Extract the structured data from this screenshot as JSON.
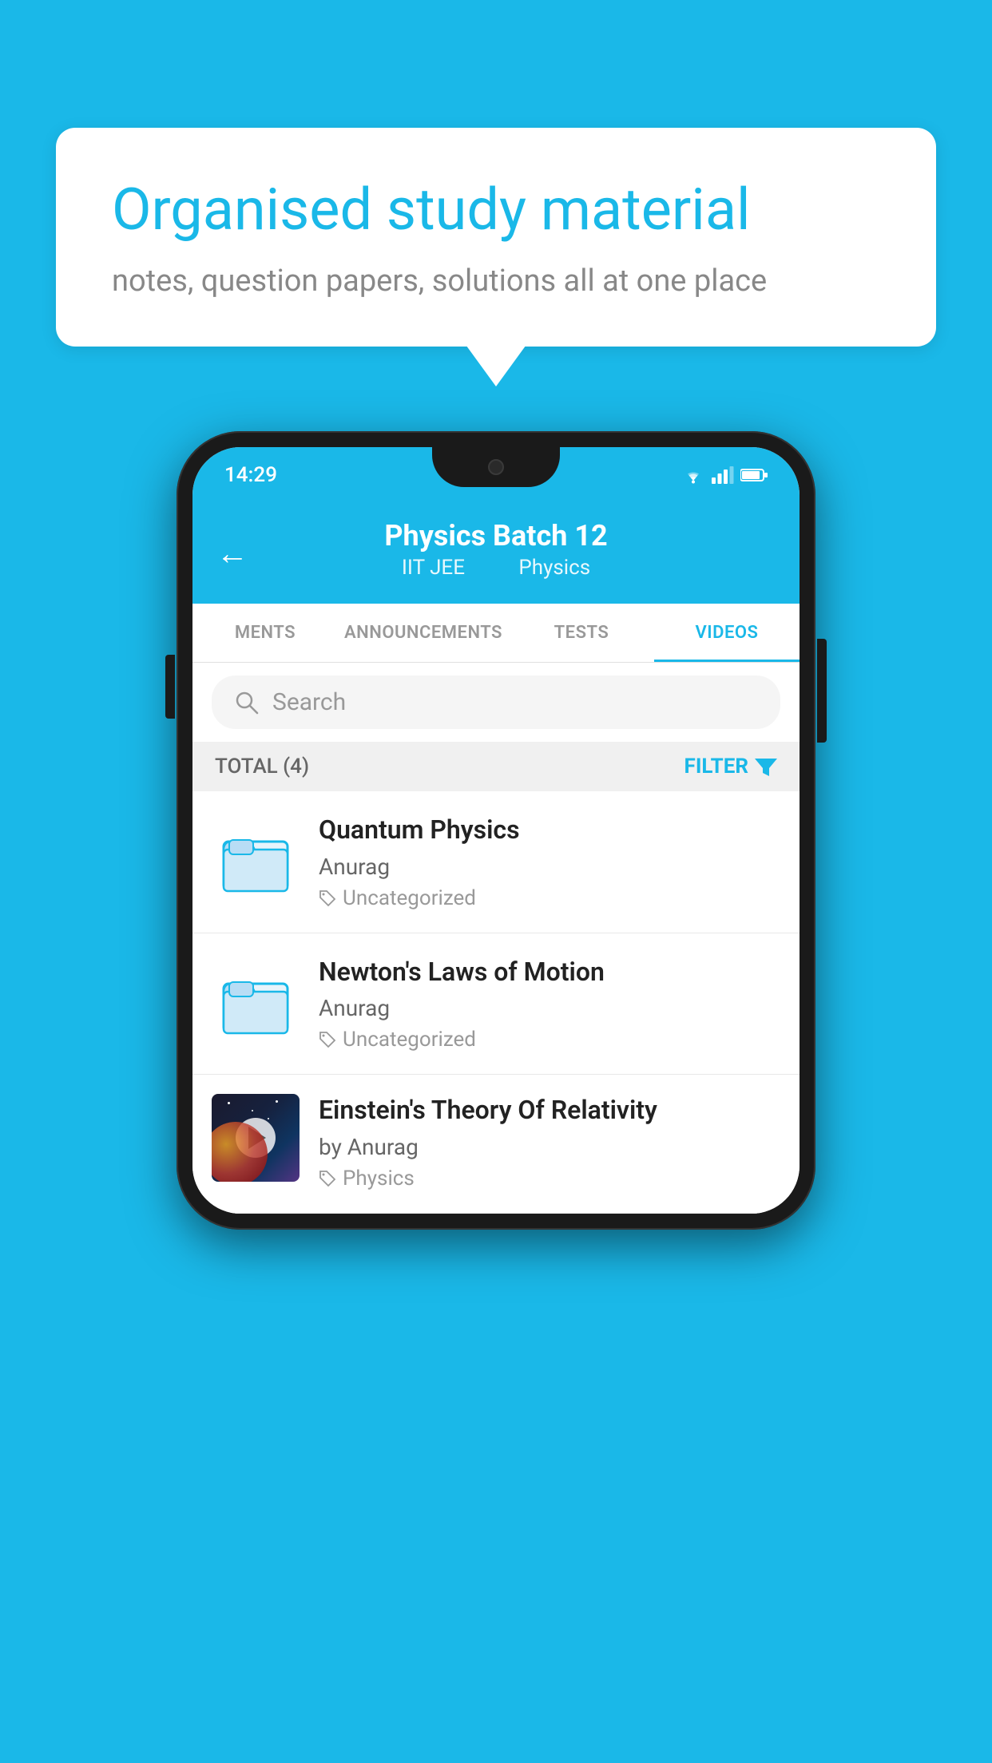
{
  "background": {
    "color": "#1ab8e8"
  },
  "speech_bubble": {
    "title": "Organised study material",
    "subtitle": "notes, question papers, solutions all at one place"
  },
  "phone": {
    "status_bar": {
      "time": "14:29",
      "icons": [
        "wifi",
        "signal",
        "battery"
      ]
    },
    "header": {
      "back_label": "←",
      "title": "Physics Batch 12",
      "subtitle_part1": "IIT JEE",
      "subtitle_part2": "Physics"
    },
    "tabs": [
      {
        "label": "MENTS",
        "active": false
      },
      {
        "label": "ANNOUNCEMENTS",
        "active": false
      },
      {
        "label": "TESTS",
        "active": false
      },
      {
        "label": "VIDEOS",
        "active": true
      }
    ],
    "search": {
      "placeholder": "Search"
    },
    "filter": {
      "total_label": "TOTAL (4)",
      "filter_label": "FILTER"
    },
    "videos": [
      {
        "id": 1,
        "title": "Quantum Physics",
        "author": "Anurag",
        "category": "Uncategorized",
        "has_thumbnail": false
      },
      {
        "id": 2,
        "title": "Newton's Laws of Motion",
        "author": "Anurag",
        "category": "Uncategorized",
        "has_thumbnail": false
      },
      {
        "id": 3,
        "title": "Einstein's Theory Of Relativity",
        "author": "by Anurag",
        "category": "Physics",
        "has_thumbnail": true
      }
    ]
  }
}
